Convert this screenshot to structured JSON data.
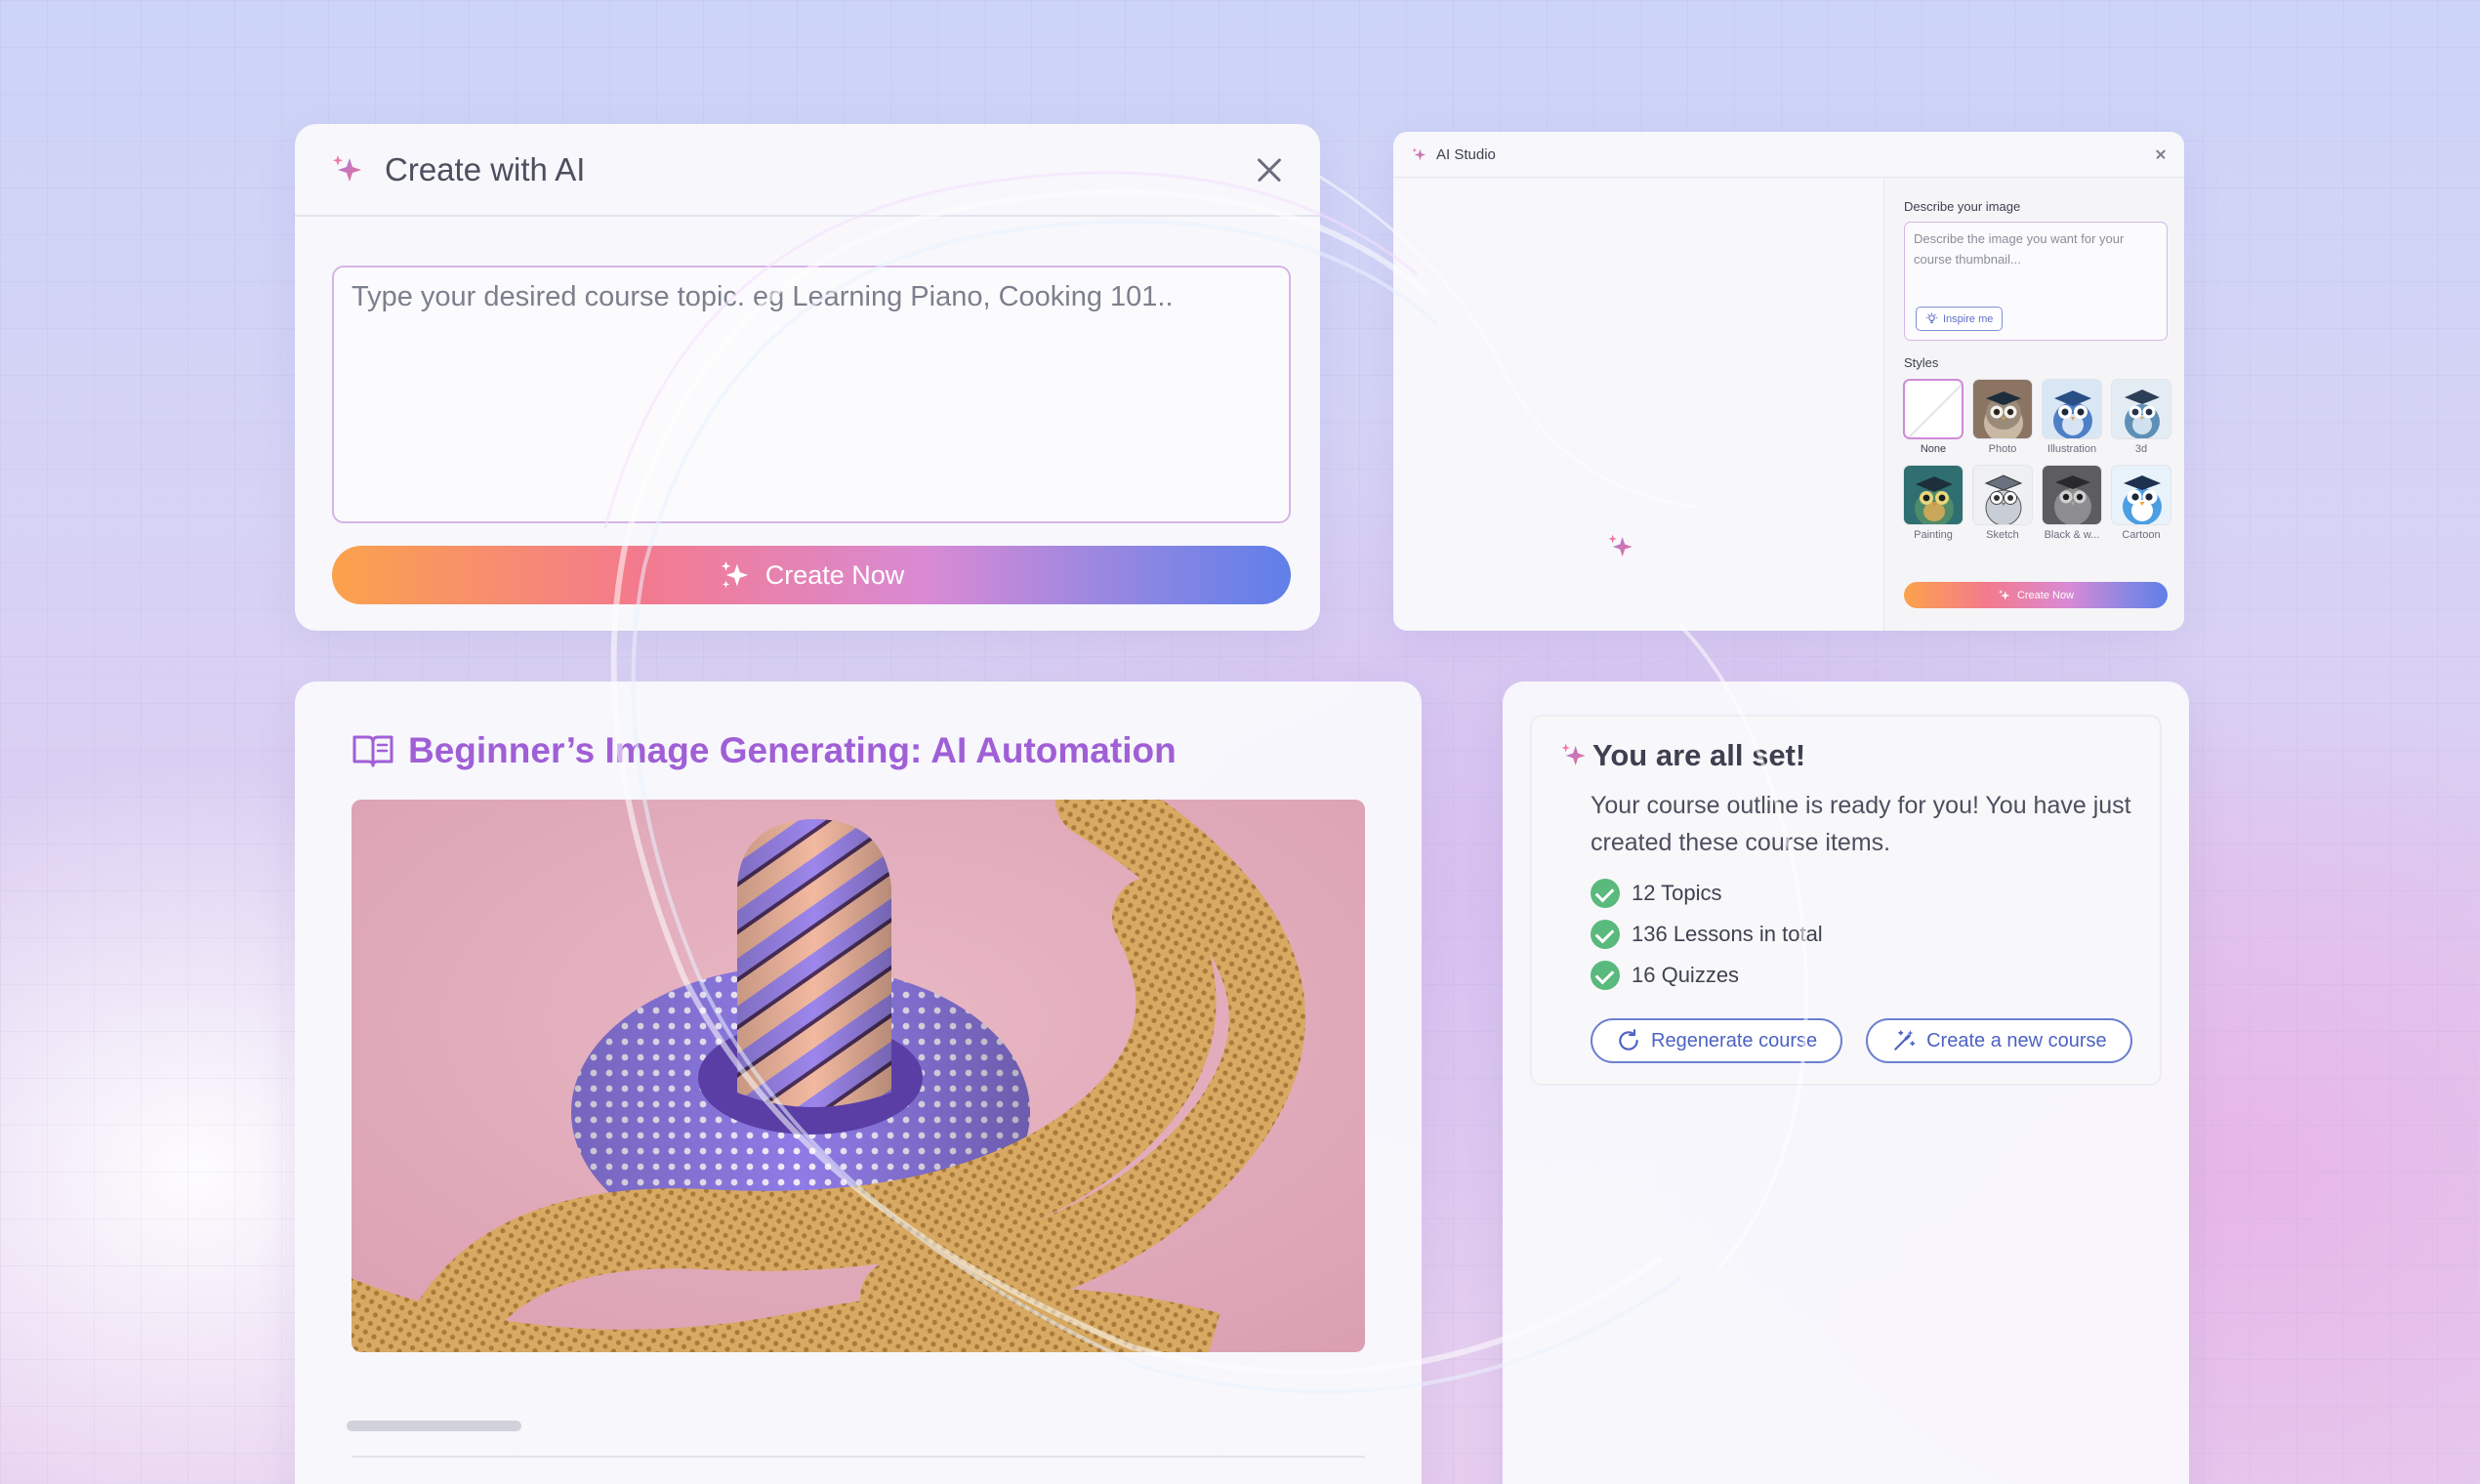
{
  "create_with_ai": {
    "title": "Create with AI",
    "topic_placeholder": "Type your desired course topic. eg Learning Piano, Cooking 101..",
    "create_button": "Create Now"
  },
  "ai_studio": {
    "title": "AI Studio",
    "describe_label": "Describe your image",
    "describe_placeholder": "Describe the image you want for your course thumbnail...",
    "inspire_button": "Inspire me",
    "styles_label": "Styles",
    "styles": [
      {
        "name": "None",
        "selected": true
      },
      {
        "name": "Photo",
        "selected": false
      },
      {
        "name": "Illustration",
        "selected": false
      },
      {
        "name": "3d",
        "selected": false
      },
      {
        "name": "Painting",
        "selected": false
      },
      {
        "name": "Sketch",
        "selected": false
      },
      {
        "name": "Black & w...",
        "selected": false
      },
      {
        "name": "Cartoon",
        "selected": false
      }
    ],
    "create_button": "Create Now"
  },
  "course": {
    "title": "Beginner’s Image Generating: AI Automation"
  },
  "all_set": {
    "title": "You are all set!",
    "message": "Your course outline is ready for you! You have just created these course items.",
    "items": [
      "12 Topics",
      "136 Lessons in total",
      "16 Quizzes"
    ],
    "regenerate_button": "Regenerate course",
    "new_course_button": "Create a new course"
  },
  "colors": {
    "accent_purple": "#a05fd6",
    "button_blue": "#4d62c2",
    "check_green": "#5ab97c",
    "gradient_start": "#fba24c",
    "gradient_end": "#5f7fe8"
  }
}
